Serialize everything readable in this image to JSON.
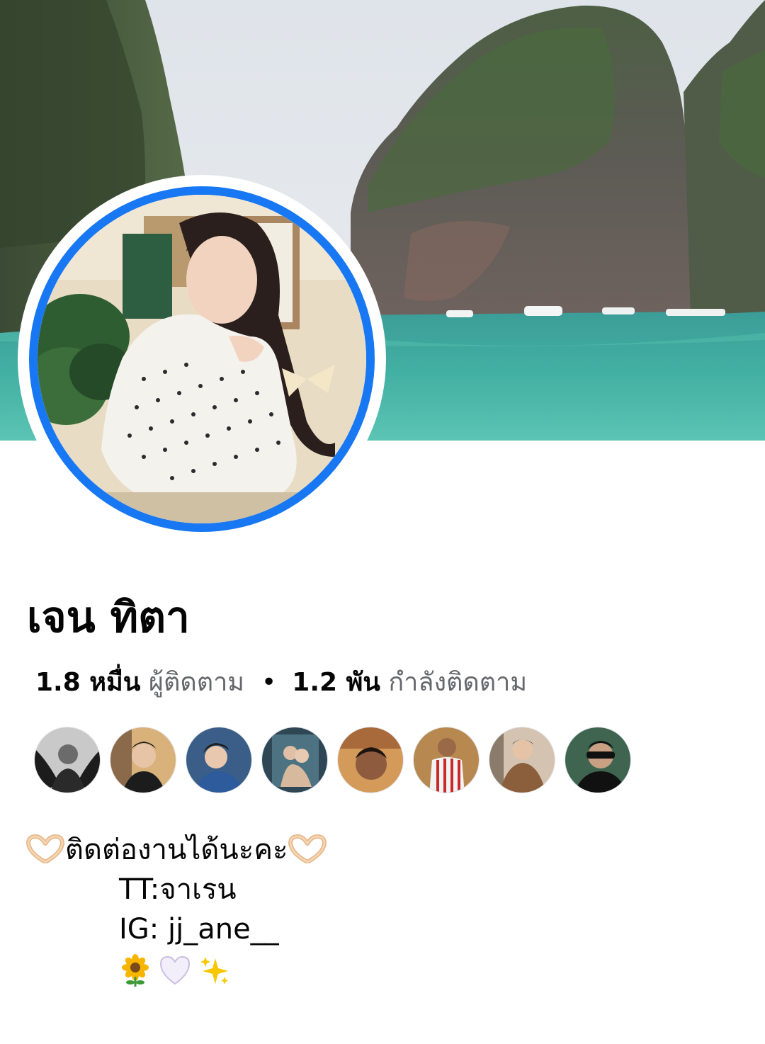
{
  "profile": {
    "name": "เจน ทิตา",
    "followers_count": "1.8 หมื่น",
    "followers_label": "ผู้ติดตาม",
    "separator": "•",
    "following_count": "1.2 พัน",
    "following_label": "กำลังติดตาม"
  },
  "friends": [
    {
      "icon": "friend-avatar"
    },
    {
      "icon": "friend-avatar"
    },
    {
      "icon": "friend-avatar"
    },
    {
      "icon": "friend-avatar"
    },
    {
      "icon": "friend-avatar"
    },
    {
      "icon": "friend-avatar"
    },
    {
      "icon": "friend-avatar"
    },
    {
      "icon": "friend-avatar"
    }
  ],
  "bio": {
    "line1": "ติดต่องานได้นะคะ",
    "line2": "TT:จาเรน",
    "line3": "IG: jj_ane__",
    "emoji_icons": [
      "heart-hands-icon",
      "sunflower-icon",
      "white-heart-icon",
      "sparkles-icon"
    ]
  },
  "colors": {
    "accent_ring": "#1877f2",
    "secondary_text": "#65676b"
  }
}
